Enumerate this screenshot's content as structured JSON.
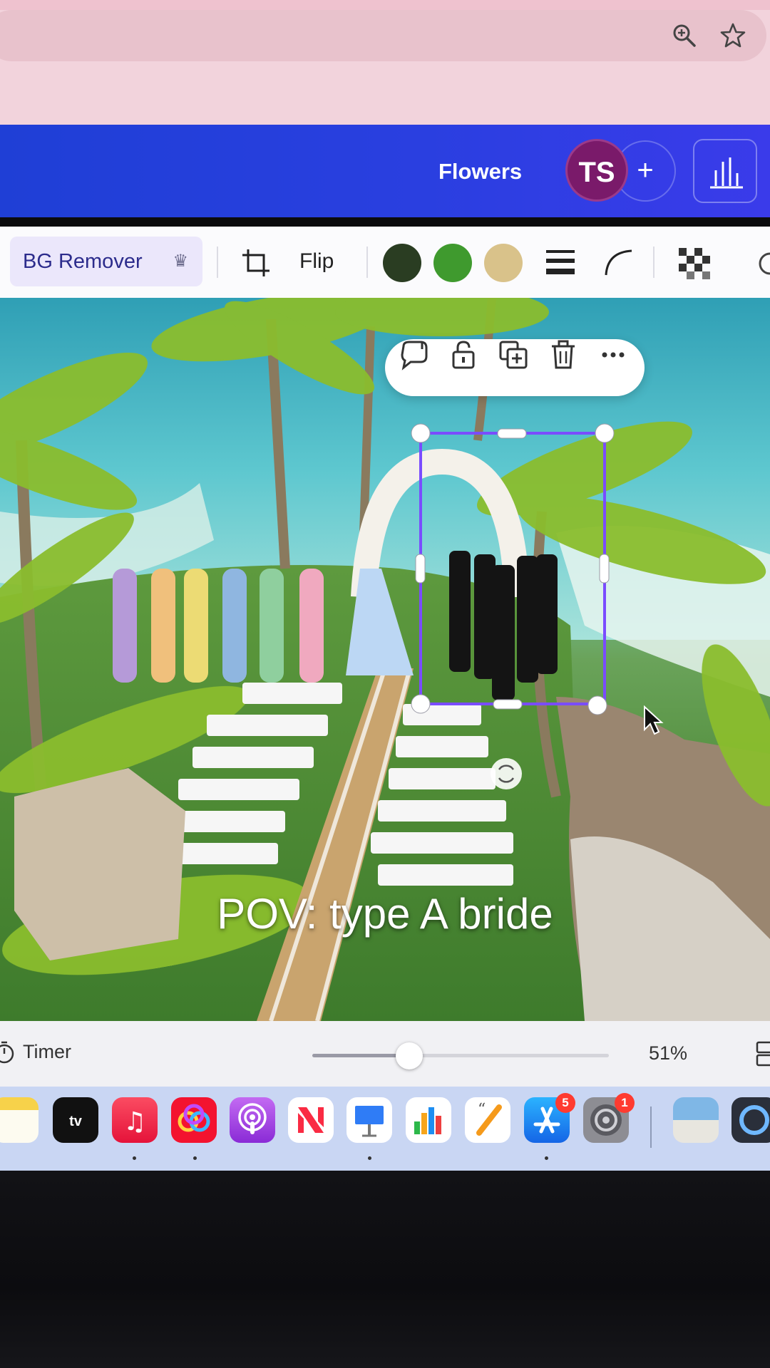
{
  "browser": {
    "icons": [
      "zoom-icon",
      "bookmark-star-icon"
    ]
  },
  "header": {
    "design_title": "Flowers",
    "avatar_initials": "TS",
    "add_label": "+",
    "icons": [
      "insights-chart-icon"
    ]
  },
  "toolbar": {
    "bg_remover_label": "BG Remover",
    "flip_label": "Flip",
    "swatches": [
      "#2a3d22",
      "#3f9a2e",
      "#d9c28a"
    ],
    "icons": [
      "premium-crown-icon",
      "crop-icon",
      "line-weight-icon",
      "corner-rounding-icon",
      "transparency-icon"
    ]
  },
  "element_menu": {
    "icons": [
      "comment-add-icon",
      "lock-icon",
      "duplicate-icon",
      "delete-icon",
      "more-icon"
    ]
  },
  "canvas": {
    "caption": "POV: type A bride"
  },
  "bottom_bar": {
    "timer_label": "Timer",
    "zoom_label": "51%",
    "zoom_value": 51
  },
  "dock": {
    "apps": [
      {
        "name": "notes",
        "badge": ""
      },
      {
        "name": "apple-tv",
        "badge": ""
      },
      {
        "name": "music",
        "badge": ""
      },
      {
        "name": "creative-cloud",
        "badge": ""
      },
      {
        "name": "podcasts",
        "badge": ""
      },
      {
        "name": "news",
        "badge": ""
      },
      {
        "name": "keynote",
        "badge": ""
      },
      {
        "name": "numbers",
        "badge": ""
      },
      {
        "name": "pages",
        "badge": ""
      },
      {
        "name": "app-store",
        "badge": "5"
      },
      {
        "name": "system-settings",
        "badge": "1"
      },
      {
        "name": "preview",
        "badge": ""
      },
      {
        "name": "quicktime",
        "badge": ""
      }
    ]
  }
}
